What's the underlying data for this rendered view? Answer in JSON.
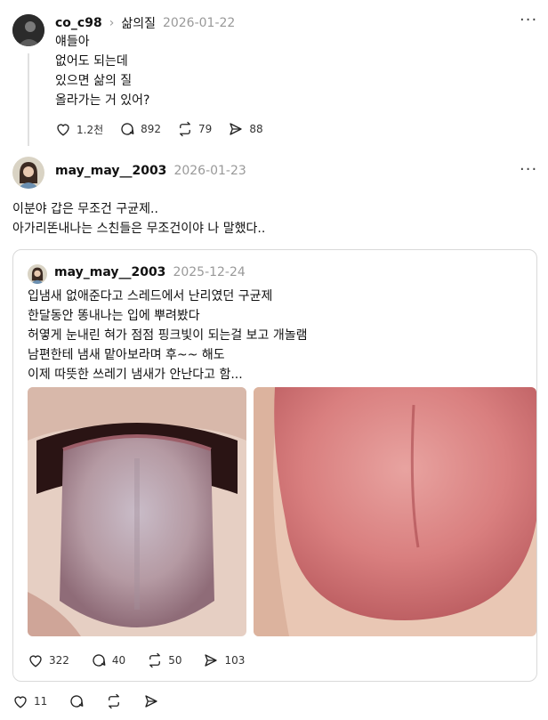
{
  "post1": {
    "username": "co_c98",
    "community": "삶의질",
    "date": "2026-01-22",
    "lines": [
      "얘들아",
      "없어도 되는데",
      "있으면 삶의 질",
      "올라가는 거 있어?"
    ],
    "stats": {
      "likes": "1.2천",
      "comments": "892",
      "reposts": "79",
      "shares": "88"
    }
  },
  "post2": {
    "username": "may_may__2003",
    "date": "2026-01-23",
    "lines": [
      "이분야 갑은 무조건 구균제..",
      "아가리똔내나는 스친들은 무조건이야 나 말했다.."
    ],
    "stats": {
      "likes": "11"
    }
  },
  "quote": {
    "username": "may_may__2003",
    "date": "2025-12-24",
    "lines": [
      "입냄새 없애준다고 스레드에서 난리였던 구균제",
      "한달동안 똥내나는 입에 뿌려봤다",
      "허옇게 눈내린 혀가 점점 핑크빛이 되는걸 보고 개놀램",
      "남편한테 냄새 맡아보라며 후~~ 해도",
      "이제 따뜻한 쓰레기 냄새가 안난다고 함..."
    ],
    "stats": {
      "likes": "322",
      "comments": "40",
      "reposts": "50",
      "shares": "103"
    }
  },
  "colors": {
    "tongue_before": "#b59aa3",
    "tongue_after": "#d97f7f",
    "muted": "#999999"
  }
}
